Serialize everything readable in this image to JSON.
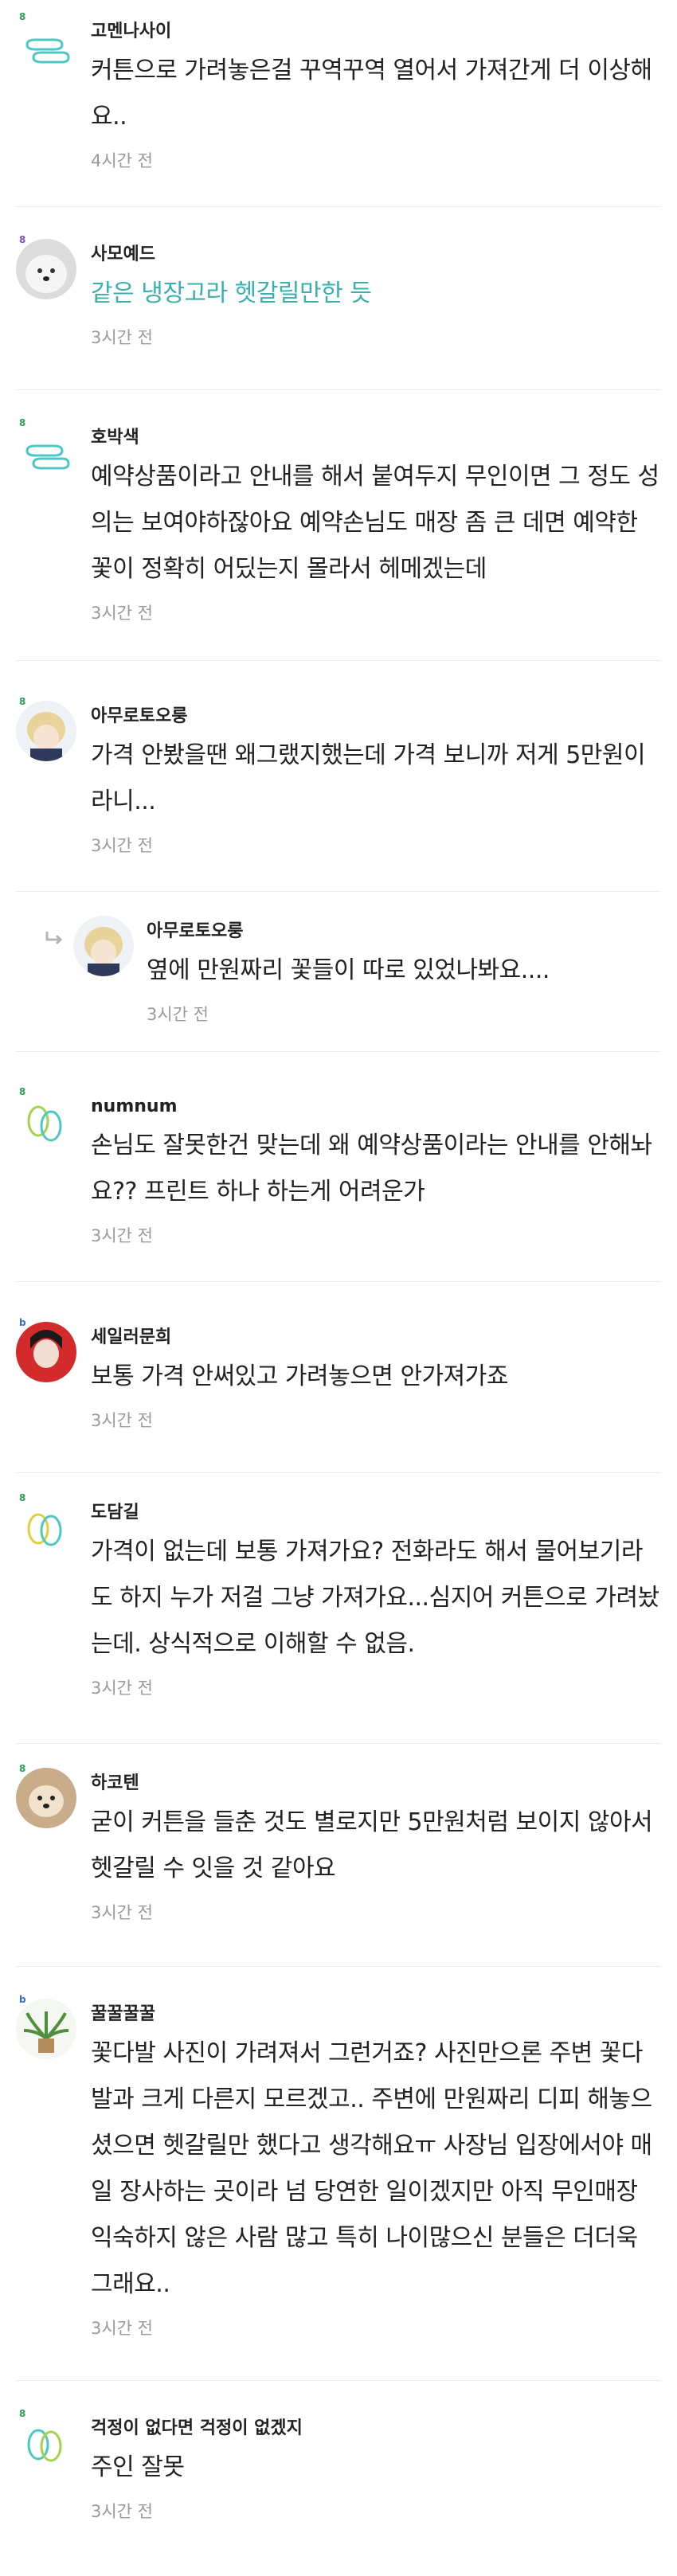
{
  "comments": [
    {
      "nick": "고멘나사이",
      "text": "커튼으로 가려놓은걸 꾸역꾸역 열어서 가져간게 더 이상해요..",
      "time": "4시간 전"
    },
    {
      "nick": "사모예드",
      "text": "같은 냉장고라 헷갈릴만한 듯",
      "time": "3시간 전"
    },
    {
      "nick": "호박색",
      "text": "예약상품이라고 안내를 해서 붙여두지 무인이면 그 정도 성의는 보여야하잖아요 예약손님도 매장 좀 큰 데면 예약한 꽃이 정확히 어딨는지 몰라서 헤메겠는데",
      "time": "3시간 전"
    },
    {
      "nick": "아무로토오룽",
      "text": "가격 안봤을땐 왜그랬지했는데 가격 보니까 저게 5만원이라니...",
      "time": "3시간 전"
    },
    {
      "nick": "아무로토오룽",
      "text": "옆에 만원짜리 꽃들이 따로 있었나봐요....",
      "time": "3시간 전"
    },
    {
      "nick": "numnum",
      "text": "손님도 잘못한건 맞는데 왜 예약상품이라는 안내를 안해놔요?? 프린트 하나 하는게 어려운가",
      "time": "3시간 전"
    },
    {
      "nick": "세일러문희",
      "text": "보통 가격 안써있고 가려놓으면 안가져가죠",
      "time": "3시간 전"
    },
    {
      "nick": "도담길",
      "text": "가격이 없는데 보통 가져가요? 전화라도 해서 물어보기라도 하지 누가 저걸 그냥 가져가요...심지어 커튼으로 가려놨는데. 상식적으로 이해할 수 없음.",
      "time": "3시간 전"
    },
    {
      "nick": "하코텐",
      "text": "굳이 커튼을 들춘 것도 별로지만 5만원처럼 보이지 않아서 헷갈릴 수 잇을 것 같아요",
      "time": "3시간 전"
    },
    {
      "nick": "꿀꿀꿀꿀",
      "text": "꽃다발 사진이 가려져서 그런거죠? 사진만으론 주변 꽃다발과 크게 다른지 모르겠고.. 주변에 만원짜리 디피 해놓으셨으면 헷갈릴만 했다고 생각해요ㅠ 사장님 입장에서야 매일 장사하는 곳이라 넘 당연한 일이겠지만 아직 무인매장 익숙하지 않은 사람 많고 특히 나이많으신 분들은 더더욱 그래요..",
      "time": "3시간 전"
    },
    {
      "nick": "걱정이 없다면 걱정이 없겠지",
      "text": "주인 잘못",
      "time": "3시간 전"
    }
  ],
  "badges": {
    "level": "8",
    "level_b": "b"
  },
  "colors": {
    "teal": "#3ab0ad",
    "badge_green": "#2aa45a",
    "time_gray": "#9a9a9a"
  },
  "icons": {
    "reply": "reply-arrow-icon"
  }
}
